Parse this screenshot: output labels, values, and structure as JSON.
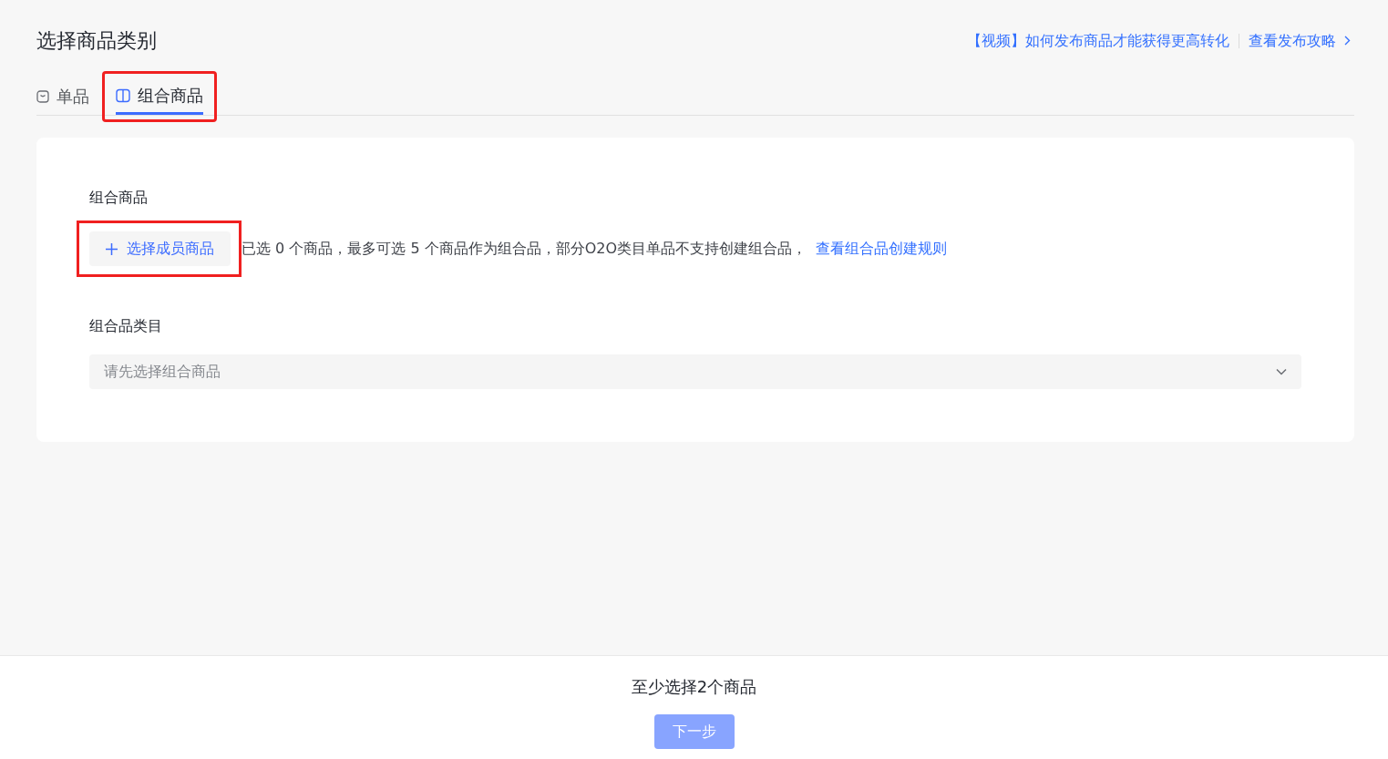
{
  "header": {
    "title": "选择商品类别",
    "links": [
      {
        "label": "【视频】如何发布商品才能获得更高转化",
        "kind": "plain"
      },
      {
        "label": "查看发布攻略",
        "kind": "more"
      }
    ]
  },
  "tabs": [
    {
      "label": "单品",
      "kind": "single",
      "selected": false,
      "highlighted": false
    },
    {
      "label": "组合商品",
      "kind": "combo",
      "selected": true,
      "highlighted": true
    }
  ],
  "combo": {
    "label": "组合商品",
    "add_button": {
      "label": "选择成员商品",
      "highlighted": true
    },
    "hint": "已选 0 个商品，最多可选 5 个商品作为组合品，部分O2O类目单品不支持创建组合品，",
    "rule_link": "查看组合品创建规则"
  },
  "category": {
    "label": "组合品类目",
    "placeholder": "请先选择组合商品"
  },
  "footer": {
    "notice": "至少选择2个商品",
    "next_button": {
      "label": "下一步",
      "disabled": true
    }
  }
}
